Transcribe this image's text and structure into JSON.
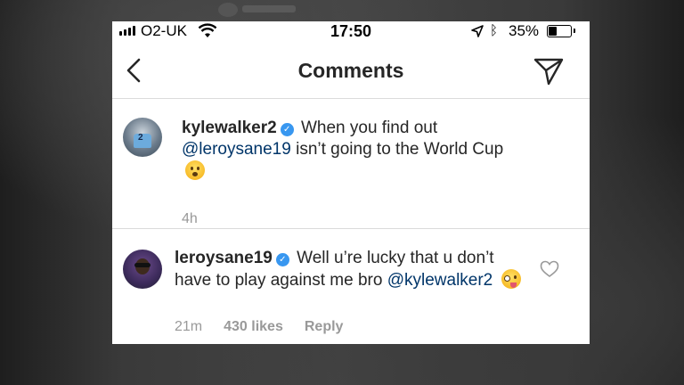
{
  "status_bar": {
    "carrier": "O2-UK",
    "time": "17:50",
    "battery": "35%",
    "battery_level": 0.35
  },
  "header": {
    "title": "Comments"
  },
  "caption": {
    "username": "kylewalker2",
    "text_before": "When you find out",
    "mention": "@leroysane19",
    "text_after": "isn’t going to the World Cup",
    "time": "4h"
  },
  "reply": {
    "username": "leroysane19",
    "text_before": "Well u’re lucky that u don’t have to play against me bro",
    "mention": "@kylewalker2",
    "time": "21m",
    "likes": "430 likes",
    "reply_label": "Reply"
  },
  "icons": {
    "back": "chevron-left-icon",
    "send": "paper-plane-icon",
    "heart": "heart-outline-icon",
    "verified": "verified-badge-icon"
  },
  "colors": {
    "mention": "#003569",
    "verified": "#3897f0",
    "meta": "#999999"
  }
}
